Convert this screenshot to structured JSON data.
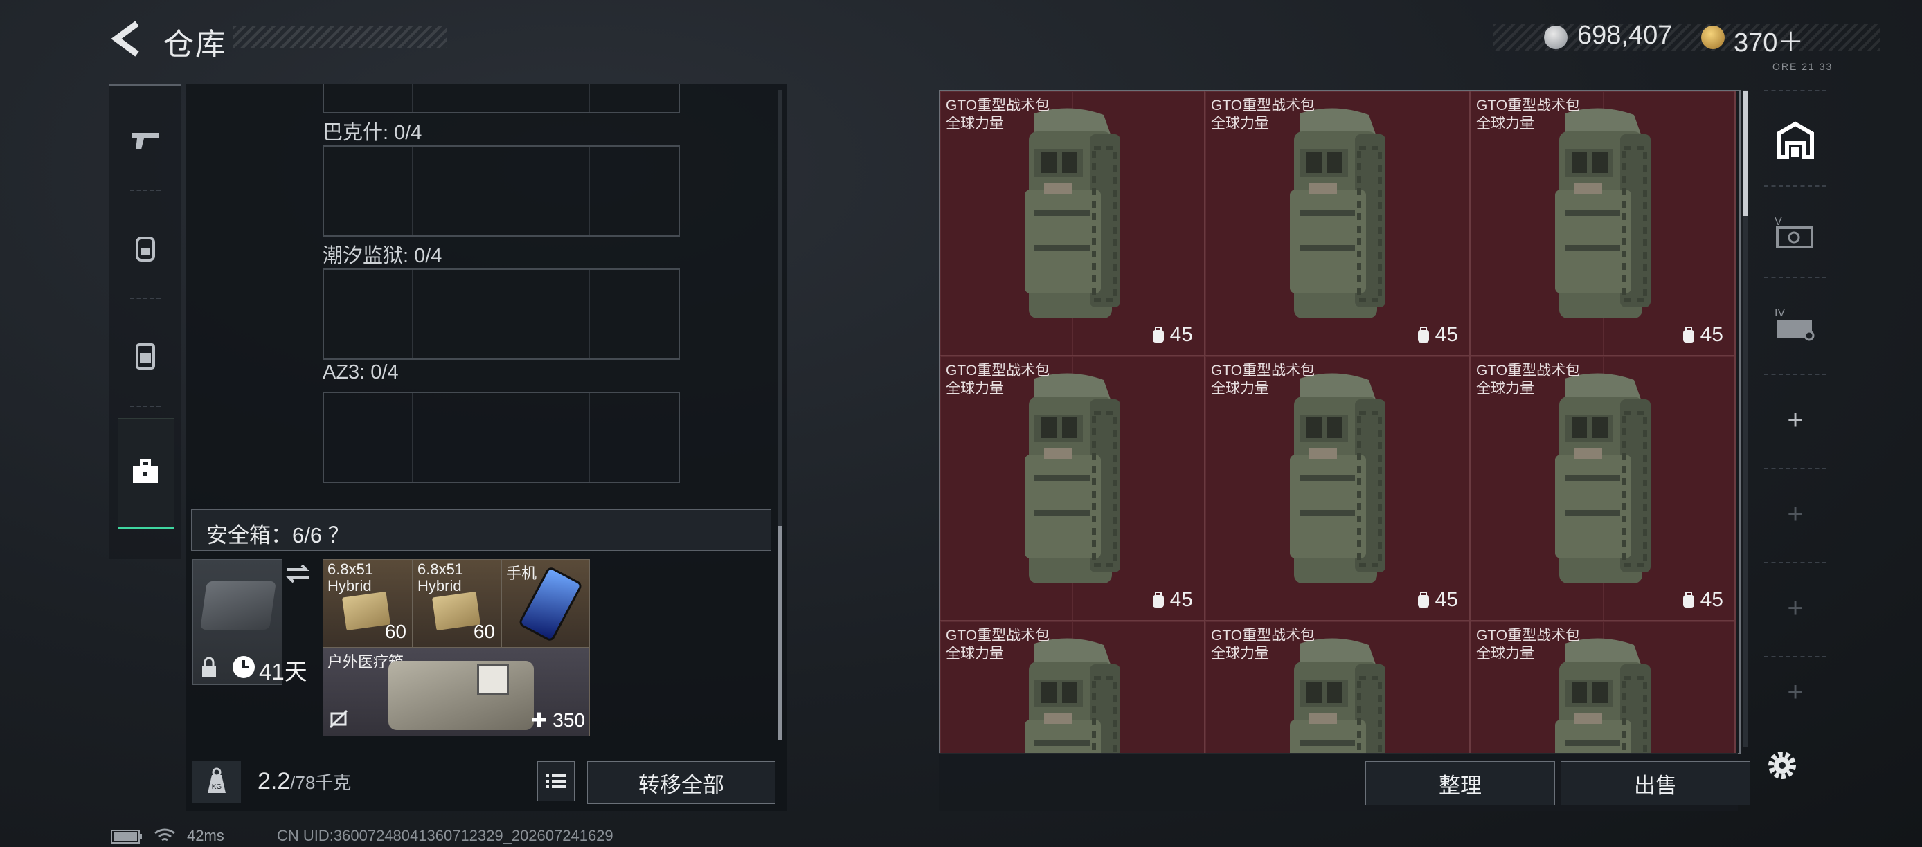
{
  "header": {
    "title": "仓库",
    "silver_amount": "698,407",
    "gold_amount": "370＋",
    "tiny_code": "ORE 21 33"
  },
  "left_nav": {
    "items": [
      "weapon-tab",
      "backpack-tab",
      "armor-tab",
      "safebox-tab"
    ],
    "active": "safebox-tab"
  },
  "inventory": {
    "slot_groups": [
      {
        "label": "巴克什: 0/4"
      },
      {
        "label": "潮汐监狱: 0/4"
      },
      {
        "label": "AZ3: 0/4"
      }
    ],
    "safebox": {
      "label": "安全箱：6/6 ？",
      "days_left": "41天",
      "items": [
        {
          "name": "6.8x51\nHybrid",
          "count": "60"
        },
        {
          "name": "6.8x51\nHybrid",
          "count": "60"
        },
        {
          "name": "手机",
          "count": ""
        },
        {
          "name": "户外医疗箱",
          "count": "350"
        }
      ]
    },
    "weight": "2.2",
    "weight_cap": "/78千克",
    "transfer_all": "转移全部"
  },
  "warehouse": {
    "items": [
      {
        "name": "GTO重型战术包",
        "sub": "全球力量",
        "count": "45"
      },
      {
        "name": "GTO重型战术包",
        "sub": "全球力量",
        "count": "45"
      },
      {
        "name": "GTO重型战术包",
        "sub": "全球力量",
        "count": "45"
      },
      {
        "name": "GTO重型战术包",
        "sub": "全球力量",
        "count": "45"
      },
      {
        "name": "GTO重型战术包",
        "sub": "全球力量",
        "count": "45"
      },
      {
        "name": "GTO重型战术包",
        "sub": "全球力量",
        "count": "45"
      },
      {
        "name": "GTO重型战术包",
        "sub": "全球力量",
        "count": ""
      },
      {
        "name": "GTO重型战术包",
        "sub": "全球力量",
        "count": ""
      },
      {
        "name": "GTO重型战术包",
        "sub": "全球力量",
        "count": ""
      }
    ],
    "sort_label": "整理",
    "sell_label": "出售"
  },
  "right_nav": {
    "items": [
      "warehouse-main",
      "storage-v",
      "storage-iv",
      "add",
      "add",
      "add",
      "add"
    ]
  },
  "status": {
    "ping": "42ms",
    "uid": "CN UID:3600724804136071232​9_202607241629"
  },
  "colors": {
    "accent": "#3fd6a0",
    "tile_red": "#4a1d24"
  }
}
